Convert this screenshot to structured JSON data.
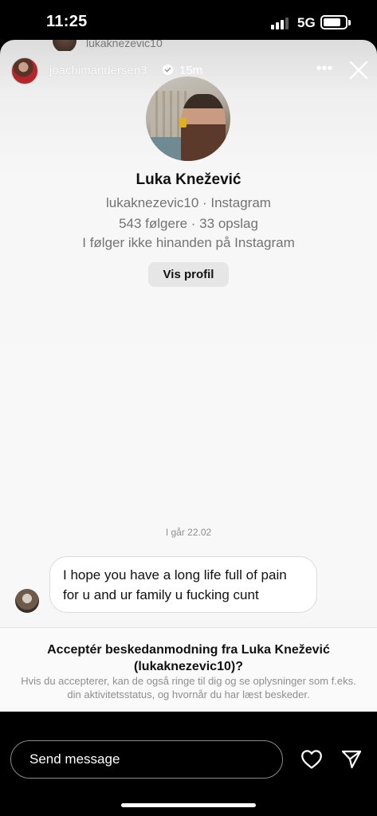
{
  "status_bar": {
    "time": "11:25",
    "network": "5G",
    "signal_bars_filled": 3,
    "signal_bars_total": 4
  },
  "peek": {
    "username": "lukaknezevic10"
  },
  "story": {
    "username": "joachimandersen3",
    "verified": true,
    "time_ago": "15m",
    "more_icon": "ellipsis-icon",
    "close_icon": "close-icon"
  },
  "profile": {
    "name": "Luka Knežević",
    "handle_line": "lukaknezevic10 · Instagram",
    "stats_line": "543 følgere · 33 opslag",
    "follow_line": "I følger ikke hinanden på Instagram",
    "view_button": "Vis profil"
  },
  "conversation": {
    "date_separator": "I går 22.02",
    "messages": [
      {
        "text": "I hope you have a long life full of pain for u and ur family u fucking cunt"
      }
    ]
  },
  "request": {
    "title": "Acceptér beskedanmodning fra Luka Knežević (lukaknezevic10)?",
    "description": "Hvis du accepterer, kan de også ringe til dig og se oplysninger som f.eks. din aktivitetsstatus, og hvornår du har læst beskeder."
  },
  "composer": {
    "placeholder": "Send message",
    "like_icon": "heart-icon",
    "send_icon": "paper-plane-icon"
  },
  "colors": {
    "background": "#000000",
    "card": "#f8f8f8",
    "muted_text": "#737373",
    "verified_badge": "#3797f0"
  }
}
